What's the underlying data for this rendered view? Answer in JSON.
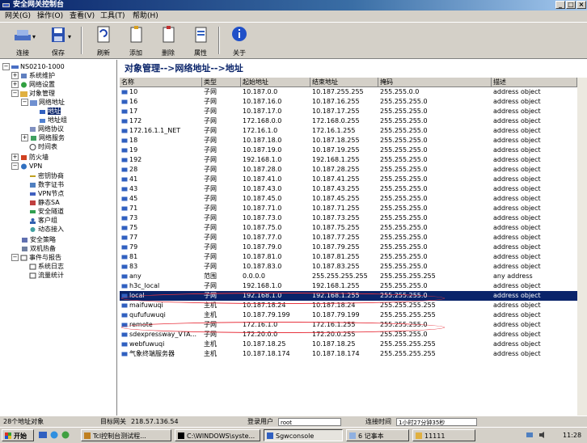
{
  "window": {
    "title": "安全网关控制台",
    "controls": [
      "_",
      "□",
      "×"
    ]
  },
  "menu": [
    "网关(G)",
    "操作(O)",
    "查看(V)",
    "工具(T)",
    "帮助(H)"
  ],
  "toolbar": {
    "connect": "连接",
    "save": "保存",
    "refresh": "刷新",
    "add": "添加",
    "delete": "删除",
    "properties": "属性",
    "about": "关于"
  },
  "tree": {
    "root": "NS0210-1000",
    "items": [
      "系统维护",
      "网络设置",
      "对象管理",
      "网络地址",
      "地址",
      "地址组",
      "网络协议",
      "网络服务",
      "时间表",
      "防火墙",
      "VPN",
      "密钥协商",
      "数字证书",
      "VPN节点",
      "静态SA",
      "安全隧道",
      "客户组",
      "动态接入",
      "安全策略",
      "双机热备",
      "事件与报告",
      "系统日志",
      "流量统计"
    ]
  },
  "main": {
    "breadcrumb": "对象管理-->网络地址-->地址",
    "columns": [
      "名称",
      "类型",
      "起始地址",
      "结束地址",
      "掩码",
      "描述"
    ],
    "rows": [
      [
        "10",
        "子网",
        "10.187.0.0",
        "10.187.255.255",
        "255.255.0.0",
        "address object"
      ],
      [
        "16",
        "子网",
        "10.187.16.0",
        "10.187.16.255",
        "255.255.255.0",
        "address object"
      ],
      [
        "17",
        "子网",
        "10.187.17.0",
        "10.187.17.255",
        "255.255.255.0",
        "address object"
      ],
      [
        "172",
        "子网",
        "172.168.0.0",
        "172.168.0.255",
        "255.255.255.0",
        "address object"
      ],
      [
        "172.16.1.1_NET",
        "子网",
        "172.16.1.0",
        "172.16.1.255",
        "255.255.255.0",
        "address object"
      ],
      [
        "18",
        "子网",
        "10.187.18.0",
        "10.187.18.255",
        "255.255.255.0",
        "address object"
      ],
      [
        "19",
        "子网",
        "10.187.19.0",
        "10.187.19.255",
        "255.255.255.0",
        "address object"
      ],
      [
        "192",
        "子网",
        "192.168.1.0",
        "192.168.1.255",
        "255.255.255.0",
        "address object"
      ],
      [
        "28",
        "子网",
        "10.187.28.0",
        "10.187.28.255",
        "255.255.255.0",
        "address object"
      ],
      [
        "41",
        "子网",
        "10.187.41.0",
        "10.187.41.255",
        "255.255.255.0",
        "address object"
      ],
      [
        "43",
        "子网",
        "10.187.43.0",
        "10.187.43.255",
        "255.255.255.0",
        "address object"
      ],
      [
        "45",
        "子网",
        "10.187.45.0",
        "10.187.45.255",
        "255.255.255.0",
        "address object"
      ],
      [
        "71",
        "子网",
        "10.187.71.0",
        "10.187.71.255",
        "255.255.255.0",
        "address object"
      ],
      [
        "73",
        "子网",
        "10.187.73.0",
        "10.187.73.255",
        "255.255.255.0",
        "address object"
      ],
      [
        "75",
        "子网",
        "10.187.75.0",
        "10.187.75.255",
        "255.255.255.0",
        "address object"
      ],
      [
        "77",
        "子网",
        "10.187.77.0",
        "10.187.77.255",
        "255.255.255.0",
        "address object"
      ],
      [
        "79",
        "子网",
        "10.187.79.0",
        "10.187.79.255",
        "255.255.255.0",
        "address object"
      ],
      [
        "81",
        "子网",
        "10.187.81.0",
        "10.187.81.255",
        "255.255.255.0",
        "address object"
      ],
      [
        "83",
        "子网",
        "10.187.83.0",
        "10.187.83.255",
        "255.255.255.0",
        "address object"
      ],
      [
        "any",
        "范围",
        "0.0.0.0",
        "255.255.255.255",
        "255.255.255.255",
        "any address"
      ],
      [
        "h3c_local",
        "子网",
        "192.168.1.0",
        "192.168.1.255",
        "255.255.255.0",
        "address object"
      ],
      [
        "local",
        "子网",
        "192.168.1.0",
        "192.168.1.255",
        "255.255.255.0",
        "address object"
      ],
      [
        "maifuwuqi",
        "主机",
        "10.187.18.24",
        "10.187.18.24",
        "255.255.255.255",
        "address object"
      ],
      [
        "qufufuwuqi",
        "主机",
        "10.187.79.199",
        "10.187.79.199",
        "255.255.255.255",
        "address object"
      ],
      [
        "remote",
        "子网",
        "172.16.1.0",
        "172.16.1.255",
        "255.255.255.0",
        "address object"
      ],
      [
        "sdexpressway_VTA...",
        "子网",
        "172.20.0.0",
        "172.20.0.255",
        "255.255.255.0",
        "address object"
      ],
      [
        "webfuwuqi",
        "主机",
        "10.187.18.25",
        "10.187.18.25",
        "255.255.255.255",
        "address object"
      ],
      [
        "气象终端服务器",
        "主机",
        "10.187.18.174",
        "10.187.18.174",
        "255.255.255.255",
        "address object"
      ]
    ],
    "selected_row": "local"
  },
  "status": {
    "count": "28个地址对象",
    "target_label": "目标网关",
    "target_value": "218.57.136.54",
    "user_label": "登录用户",
    "user_value": "root",
    "time_label": "连接时间",
    "time_value": "1小时27分钟35秒"
  },
  "taskbar": {
    "start": "开始",
    "tasks": [
      "Tcl控制台测试程...",
      "C:\\WINDOWS\\syste...",
      "Sgwconsole",
      "6 记事本",
      "11111"
    ],
    "clock": "11:28"
  },
  "colors": {
    "accent": "#0a246a",
    "annotation": "#e8343f"
  }
}
